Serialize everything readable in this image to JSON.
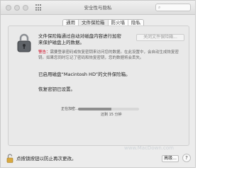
{
  "window": {
    "title": "安全性与隐私"
  },
  "tabs": [
    {
      "label": "通用",
      "active": false
    },
    {
      "label": "文件保险箱",
      "active": true
    },
    {
      "label": "防火墙",
      "active": false
    },
    {
      "label": "隐私",
      "active": false
    }
  ],
  "filevault": {
    "description": "文件保险箱通过自动对磁盘内容进行加密来保护磁盘上的数据。",
    "turn_off_button": "关闭文件保险箱...",
    "warning_label": "警告：",
    "warning_text": "需要登录密码或恢复密钥来访问您的数据。在此设置中，会自动生成恢复密钥。如果您同时忘记了密码和恢复密钥，您的数据将会丢失。",
    "status": "已启用磁盘“Macintosh HD”的文件保险箱。",
    "recovery_key": "恢复密钥已设置。",
    "progress_label": "正在加密…",
    "progress_subtext": "还剩 15 分钟",
    "progress_fraction": 0.55
  },
  "footer": {
    "lock_text": "点按锁按钮以防止再次更改。",
    "advanced_button": "高级...",
    "help_button": "?"
  },
  "watermark": "www.MacDown.com",
  "colors": {
    "warning": "#d0021b",
    "window_bg": "#ececec"
  },
  "icons": [
    "lock-icon",
    "unlocked-padlock-icon",
    "help-icon"
  ]
}
